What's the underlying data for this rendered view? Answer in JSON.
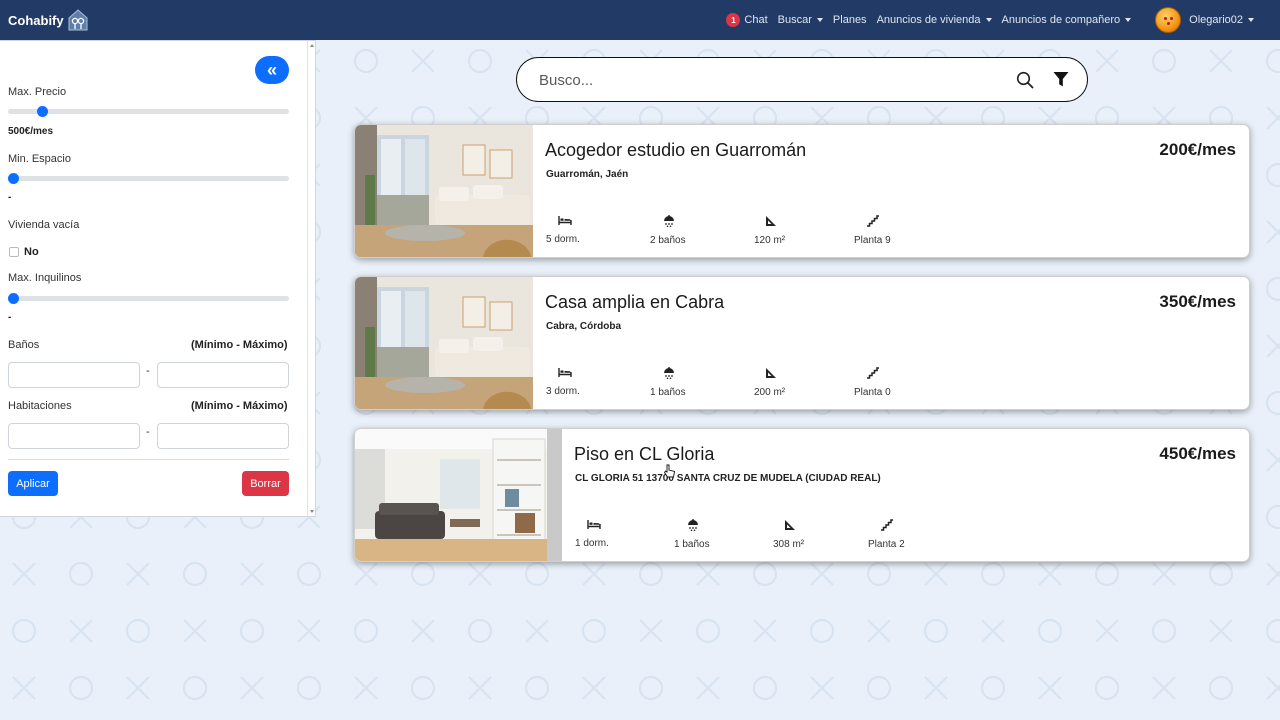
{
  "nav": {
    "brand": "Cohabify",
    "chat_badge": "1",
    "chat": "Chat",
    "buscar": "Buscar",
    "planes": "Planes",
    "anuncios_vivienda": "Anuncios de vivienda",
    "anuncios_companero": "Anuncios de compañero",
    "username": "Olegario02"
  },
  "filters": {
    "collapse_icon": "«",
    "max_precio_label": "Max. Precio",
    "max_precio_value": "500€/mes",
    "max_precio_level": 0.12,
    "min_espacio_label": "Min. Espacio",
    "min_espacio_value": "-",
    "min_espacio_level": 0,
    "vivienda_vacia_label": "Vivienda vacía",
    "vivienda_vacia_option": "No",
    "max_inquilinos_label": "Max. Inquilinos",
    "max_inquilinos_value": "-",
    "max_inquilinos_level": 0,
    "banos_label": "Baños",
    "banos_hint": "(Mínimo - Máximo)",
    "habitaciones_label": "Habitaciones",
    "habitaciones_hint": "(Mínimo - Máximo)",
    "range_dash": "-",
    "apply_label": "Aplicar",
    "clear_label": "Borrar"
  },
  "search": {
    "placeholder": "Busco..."
  },
  "listings": [
    {
      "title": "Acogedor estudio en Guarromán",
      "location": "Guarromán, Jaén",
      "price": "200€/mes",
      "bedrooms": "5 dorm.",
      "bathrooms": "2 baños",
      "area": "120 m²",
      "floor": "Planta 9"
    },
    {
      "title": "Casa amplia en Cabra",
      "location": "Cabra, Córdoba",
      "price": "350€/mes",
      "bedrooms": "3 dorm.",
      "bathrooms": "1 baños",
      "area": "200 m²",
      "floor": "Planta 0"
    },
    {
      "title": "Piso en CL Gloria",
      "location": "CL GLORIA 51 13700 SANTA CRUZ DE MUDELA (CIUDAD REAL)",
      "price": "450€/mes",
      "bedrooms": "1 dorm.",
      "bathrooms": "1 baños",
      "area": "308 m²",
      "floor": "Planta 2"
    }
  ],
  "icons": {
    "bed": "bed-icon",
    "shower": "shower-icon",
    "area": "set-square-icon",
    "floor": "stairs-icon",
    "search": "search-icon",
    "filter": "filter-icon"
  },
  "colors": {
    "navbar": "#213b66",
    "primary": "#0d6efd",
    "danger": "#dc3545",
    "background": "#e9f0f9"
  }
}
